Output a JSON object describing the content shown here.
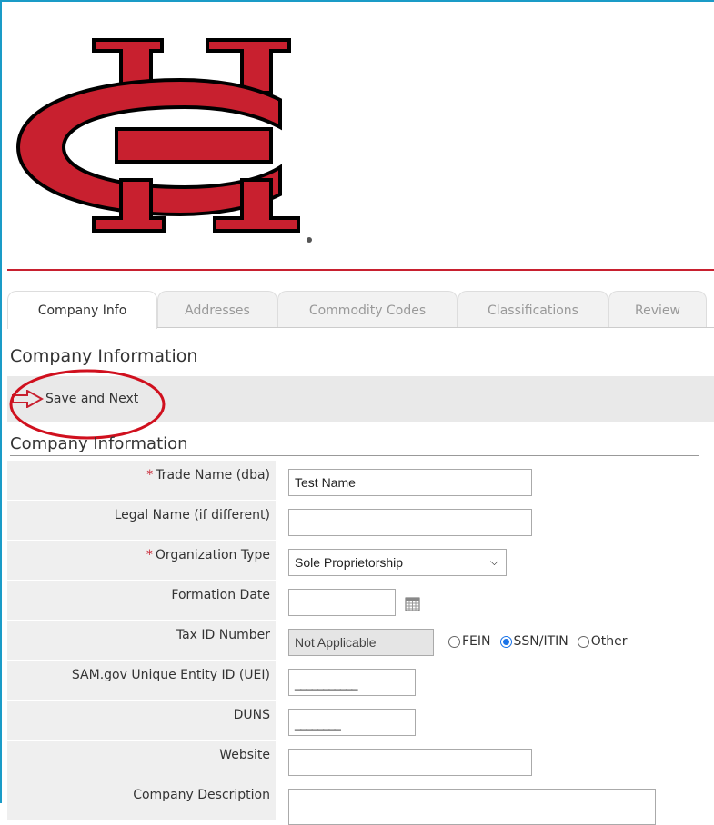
{
  "tabs": [
    {
      "label": "Company Info",
      "active": true
    },
    {
      "label": "Addresses",
      "active": false
    },
    {
      "label": "Commodity Codes",
      "active": false
    },
    {
      "label": "Classifications",
      "active": false
    },
    {
      "label": "Review",
      "active": false
    }
  ],
  "page": {
    "section_title": "Company Information",
    "subheader": "Company Information"
  },
  "toolbar": {
    "save_next_label": "Save and Next"
  },
  "form": {
    "trade_name": {
      "label": "Trade Name (dba)",
      "required": true,
      "value": "Test Name"
    },
    "legal_name": {
      "label": "Legal Name (if different)",
      "required": false,
      "value": ""
    },
    "org_type": {
      "label": "Organization Type",
      "required": true,
      "value": "Sole Proprietorship"
    },
    "formation_date": {
      "label": "Formation Date",
      "required": false,
      "value": ""
    },
    "tax_id": {
      "label": "Tax ID Number",
      "required": false,
      "value": "Not Applicable",
      "options": [
        "FEIN",
        "SSN/ITIN",
        "Other"
      ],
      "selected": "SSN/ITIN"
    },
    "uei": {
      "label": "SAM.gov Unique Entity ID (UEI)",
      "value": "___________"
    },
    "duns": {
      "label": "DUNS",
      "value": "________"
    },
    "website": {
      "label": "Website",
      "value": ""
    },
    "company_description": {
      "label": "Company Description"
    }
  },
  "colors": {
    "brand_red": "#c8202f",
    "frame_blue": "#1a9bc7",
    "radio_blue": "#1a73e8"
  }
}
